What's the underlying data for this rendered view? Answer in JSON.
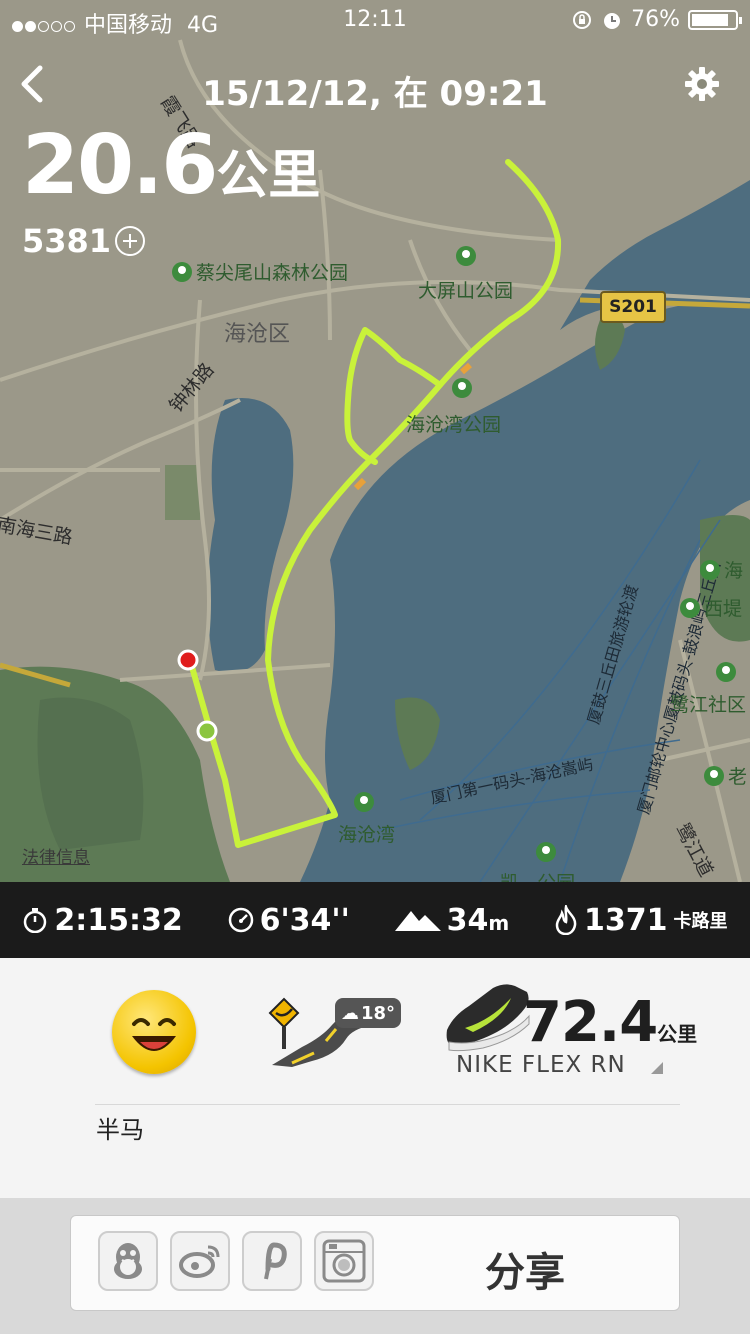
{
  "status_bar": {
    "carrier": "中国移动",
    "network": "4G",
    "time": "12:11",
    "battery": "76%"
  },
  "header": {
    "title": "15/12/12, 在 09:21"
  },
  "run": {
    "distance": "20.6",
    "distance_unit": "公里",
    "nikefuel": "5381"
  },
  "map": {
    "labels": {
      "xiafei_road": "霞飞路",
      "caijianwei_park": "蔡尖尾山森林公园",
      "dapingshan_park": "大屏山公园",
      "s201": "S201",
      "haicang_district": "海沧区",
      "zhonglin_road": "钟林路",
      "haicangwan_park": "海沧湾公园",
      "nanhai_road": "南海三路",
      "haicang_bay": "海沧湾",
      "ferry_1": "厦门第一码头-海沧嵩屿",
      "ferry_2": "厦鼓三丘田旅游轮渡",
      "ferry_3": "厦门邮轮中心厦鼓码头-鼓浪屿三丘田",
      "hai_partial": "海",
      "xidi": "西堤",
      "lujiang_community": "鹭江社区",
      "lao_partial": "老",
      "lujiang_road": "鹭江道",
      "bottom_partial": "凯...公园"
    },
    "legal": "法律信息"
  },
  "stats": {
    "duration": "2:15:32",
    "pace": "6'34''",
    "elevation": "34",
    "elevation_unit": "m",
    "calories": "1371",
    "calories_unit": "卡路里"
  },
  "summary": {
    "temperature": "18°",
    "shoe_distance": "72.4",
    "shoe_unit": "公里",
    "shoe_name": "NIKE FLEX RN",
    "note": "半马"
  },
  "share": {
    "label": "分享"
  }
}
